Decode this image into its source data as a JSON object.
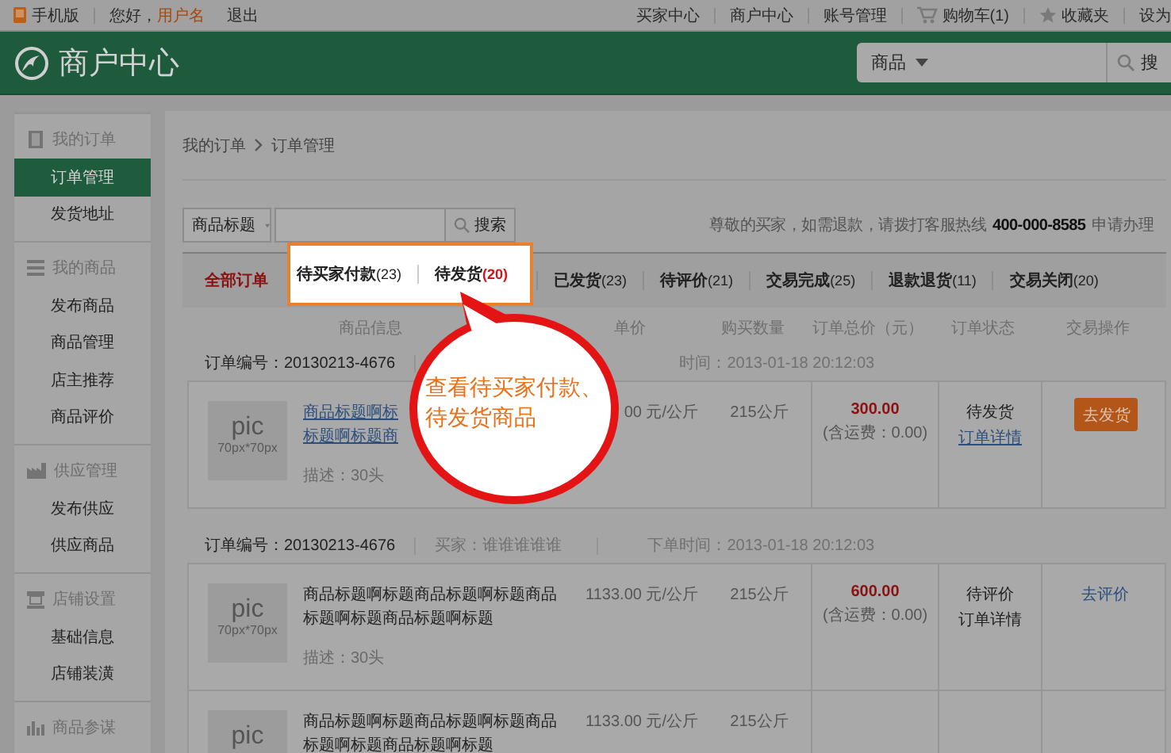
{
  "top_bar": {
    "mobile_link": "手机版",
    "greeting": "您好，",
    "username": "用户名",
    "logout": "退出",
    "links": [
      {
        "kind": "text",
        "label": "买家中心"
      },
      {
        "kind": "text",
        "label": "商户中心"
      },
      {
        "kind": "text",
        "label": "账号管理"
      },
      {
        "kind": "cart",
        "label": "购物车(1)"
      },
      {
        "kind": "star",
        "label": "收藏夹"
      },
      {
        "kind": "text",
        "label": "设为"
      }
    ]
  },
  "header": {
    "title": "商户中心",
    "search": {
      "category": "商品",
      "button": "搜"
    }
  },
  "sidebar": {
    "groups": [
      {
        "kind": "book",
        "title": "我的订单",
        "items": [
          {
            "label": "订单管理",
            "selected": true
          },
          {
            "label": "发货地址",
            "selected": false
          }
        ]
      },
      {
        "kind": "list",
        "title": "我的商品",
        "items": [
          {
            "label": "发布商品",
            "selected": false
          },
          {
            "label": "商品管理",
            "selected": false
          },
          {
            "label": "店主推荐",
            "selected": false
          },
          {
            "label": "商品评价",
            "selected": false
          }
        ]
      },
      {
        "kind": "factory",
        "title": "供应管理",
        "items": [
          {
            "label": "发布供应",
            "selected": false
          },
          {
            "label": "供应商品",
            "selected": false
          }
        ]
      },
      {
        "kind": "desk",
        "title": "店铺设置",
        "items": [
          {
            "label": "基础信息",
            "selected": false
          },
          {
            "label": "店铺装潢",
            "selected": false
          }
        ]
      },
      {
        "kind": "chart",
        "title": "商品参谋"
      }
    ]
  },
  "breadcrumb": [
    "我的订单",
    "订单管理"
  ],
  "search": {
    "field": "商品标题",
    "button": "搜索"
  },
  "notice": {
    "text": "尊敬的买家，如需退款，请拨打客服热线",
    "phone": "400-000-8585",
    "suffix": "申请办理"
  },
  "tabs": [
    {
      "label": "全部订单",
      "selected": true,
      "highlighted": false
    },
    {
      "label": "待买家付款",
      "count": "(23)",
      "count_alert": false,
      "selected": false,
      "highlighted": true
    },
    {
      "label": "待发货",
      "count": "(20)",
      "count_alert": true,
      "selected": false,
      "highlighted": true
    },
    {
      "label": "已发货",
      "count": "(23)",
      "count_alert": false,
      "selected": false,
      "highlighted": false
    },
    {
      "label": "待评价",
      "count": "(21)",
      "count_alert": false,
      "selected": false,
      "highlighted": false
    },
    {
      "label": "交易完成",
      "count": "(25)",
      "count_alert": false,
      "selected": false,
      "highlighted": false
    },
    {
      "label": "退款退货",
      "count": "(11)",
      "count_alert": false,
      "selected": false,
      "highlighted": false
    },
    {
      "label": "交易关闭",
      "count": "(20)",
      "count_alert": false,
      "selected": false,
      "highlighted": false
    }
  ],
  "columns": [
    "商品信息",
    "单价",
    "购买数量",
    "订单总价（元）",
    "订单状态",
    "交易操作"
  ],
  "orders": [
    {
      "number": "订单编号：20130213-4676",
      "time": "时间：2013-01-18 20:12:03",
      "total": "300.00",
      "shipping": "(含运费：0.00)",
      "status": "待发货",
      "detail": "订单详情",
      "detail_link": true,
      "action": {
        "kind": "button",
        "label": "去发货"
      },
      "items": [
        {
          "pic_label": "pic",
          "pic_size": "70px*70px",
          "title_lines": [
            "商品标题啊标",
            "标题啊标题商"
          ],
          "title_link": true,
          "description": "描述：30头",
          "unit_price": "00 元/公斤",
          "quantity": "215公斤"
        }
      ]
    },
    {
      "number": "订单编号：20130213-4676",
      "buyer": "买家：谁谁谁谁谁",
      "time": "下单时间：2013-01-18 20:12:03",
      "total": "600.00",
      "shipping": "(含运费：0.00)",
      "status": "待评价",
      "detail": "订单详情",
      "detail_link": false,
      "action": {
        "kind": "link",
        "label": "去评价"
      },
      "items": [
        {
          "pic_label": "pic",
          "pic_size": "70px*70px",
          "title_lines": [
            "商品标题啊标题商品标题啊标题商品",
            "标题啊标题商品标题啊标题"
          ],
          "title_link": false,
          "description": "描述：30头",
          "unit_price": "1133.00 元/公斤",
          "quantity": "215公斤"
        },
        {
          "pic_label": "pic",
          "title_lines": [
            "商品标题啊标题商品标题啊标题商品",
            "标题啊标题商品标题啊标题"
          ],
          "title_link": false,
          "unit_price": "1133.00 元/公斤",
          "quantity": "215公斤"
        }
      ]
    }
  ],
  "callout": {
    "lines": [
      "查看待买家付款、",
      "待发货商品"
    ]
  }
}
